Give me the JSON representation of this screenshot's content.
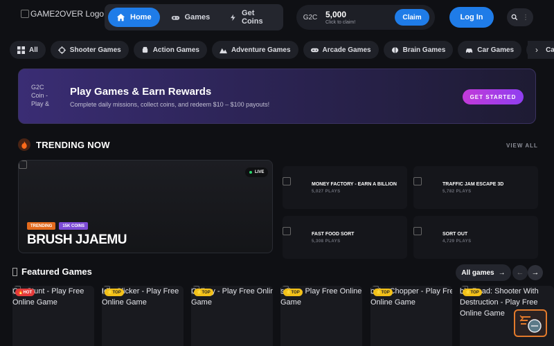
{
  "header": {
    "logo_alt": "GAME2OVER Logo",
    "nav": [
      {
        "label": "Home",
        "icon": "home-icon",
        "active": true
      },
      {
        "label": "Games",
        "icon": "gamepad-icon",
        "active": false
      },
      {
        "label": "Get Coins",
        "icon": "bolt-icon",
        "active": false
      }
    ],
    "coins": {
      "img_alt": "G2C",
      "amount": "5,000",
      "subtitle": "Click to claim!",
      "claim_label": "Claim"
    },
    "login_label": "Log In",
    "search_icon": "search-icon",
    "more_icon": "dots-vertical-icon"
  },
  "categories": [
    {
      "label": "All",
      "icon": "grid-icon"
    },
    {
      "label": "Shooter Games",
      "icon": "crosshair-icon"
    },
    {
      "label": "Action Games",
      "icon": "fist-icon"
    },
    {
      "label": "Adventure Games",
      "icon": "mountain-icon"
    },
    {
      "label": "Arcade Games",
      "icon": "gamepad-icon"
    },
    {
      "label": "Brain Games",
      "icon": "brain-icon"
    },
    {
      "label": "Car Games",
      "icon": "car-icon"
    },
    {
      "label": "Casua",
      "icon": "cards-icon"
    }
  ],
  "category_next": "›",
  "banner": {
    "img_alt": "G2C Coin - Play &",
    "title": "Play Games & Earn Rewards",
    "subtitle": "Complete daily missions, collect coins, and redeem $10 – $100 payouts!",
    "cta_label": "GET STARTED",
    "gradient_start": "#3a2d74",
    "cta_color": "#c23ad9"
  },
  "trending": {
    "title": "TRENDING NOW",
    "view_all": "VIEW ALL",
    "featured": {
      "live_label": "LIVE",
      "badges": [
        "TRENDING",
        "15K COINS"
      ],
      "title": "BRUSH JJAEMU"
    },
    "items": [
      {
        "title": "MONEY FACTORY - EARN A BILLION",
        "plays": "5,027 PLAYS"
      },
      {
        "title": "TRAFFIC JAM ESCAPE 3D",
        "plays": "5,782 PLAYS"
      },
      {
        "title": "FAST FOOD SORT",
        "plays": "5,308 PLAYS"
      },
      {
        "title": "SORT OUT",
        "plays": "4,729 PLAYS"
      }
    ]
  },
  "featured": {
    "title": "Featured Games",
    "all_games_label": "All games",
    "all_games_arrow": "→",
    "prev_arrow": "←",
    "next_arrow": "→",
    "games": [
      {
        "alt": "     Car Stunt - Play Free Online Game",
        "badge": "HOT",
        "badge_type": "hot"
      },
      {
        "alt": "        Idle Clicker - Play Free Online Game",
        "badge": "TOP",
        "badge_type": "top"
      },
      {
        "alt": "        Gallery - Play Free Online Game",
        "badge": "TOP",
        "badge_type": "top"
      },
      {
        "alt": "        s Pro - Play Free Online Game",
        "badge": "TOP",
        "badge_type": "top"
      },
      {
        "alt": "        o the Chopper - Play Free Online Game",
        "badge": "TOP",
        "badge_type": "top"
      },
      {
        "alt": "        bie Road: Shooter With Destruction - Play Free Online Game",
        "badge": "TOP",
        "badge_type": "top"
      }
    ]
  },
  "colors": {
    "accent": "#1f7ce8",
    "background": "#0f1014",
    "hot": "#e33a3a",
    "top": "#f2c019",
    "live": "#2bd36b"
  }
}
